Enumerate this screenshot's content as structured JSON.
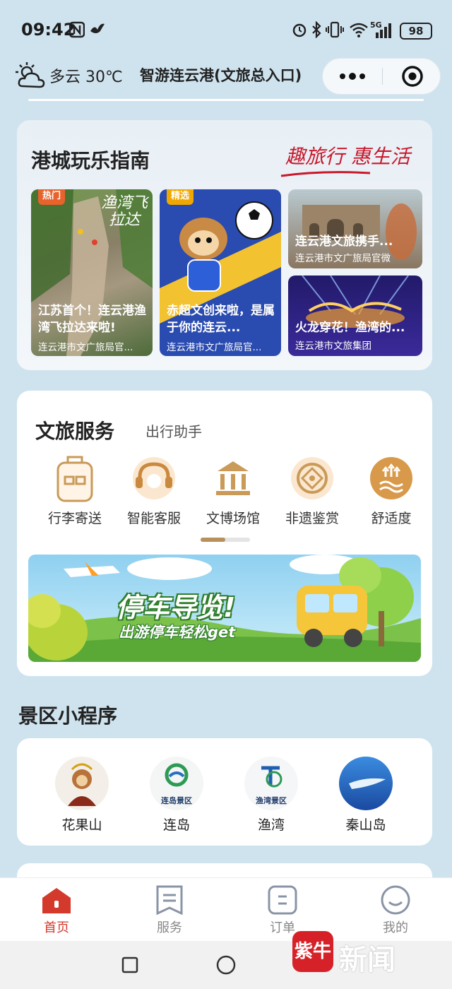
{
  "status_bar": {
    "time": "09:42",
    "battery": "98",
    "network": "5G"
  },
  "header": {
    "weather": "多云 30℃",
    "title": "智游连云港(文旅总入口)"
  },
  "guide": {
    "title": "港城玩乐指南",
    "slogan": "趣旅行 惠生活",
    "tiles": [
      {
        "tag": "热门",
        "art_text": "渔湾飞拉达",
        "title": "江苏首个！连云港渔湾飞拉达来啦!",
        "source": "连云港市文广旅局官..."
      },
      {
        "tag": "精选",
        "title": "赤超文创来啦，是属于你的连云...",
        "source": "连云港市文广旅局官..."
      },
      {
        "title": "连云港文旅携手...",
        "source": "连云港市文广旅局官微"
      },
      {
        "title": "火龙穿花！渔湾的...",
        "source": "连云港市文旅集团"
      }
    ]
  },
  "services": {
    "tabs": [
      "文旅服务",
      "出行助手"
    ],
    "items": [
      {
        "label": "行李寄送",
        "icon": "luggage-icon"
      },
      {
        "label": "智能客服",
        "icon": "headset-icon"
      },
      {
        "label": "文博场馆",
        "icon": "museum-icon"
      },
      {
        "label": "非遗鉴赏",
        "icon": "heritage-icon"
      },
      {
        "label": "舒适度",
        "icon": "comfort-icon"
      }
    ],
    "page_indicator": 0.5,
    "banner": {
      "title": "停车导览!",
      "subtitle": "出游停车轻松get"
    }
  },
  "mini_programs": {
    "title": "景区小程序",
    "items": [
      {
        "label": "花果山"
      },
      {
        "label": "连岛",
        "logo_text": "连岛景区"
      },
      {
        "label": "渔湾",
        "logo_text": "渔湾景区"
      },
      {
        "label": "秦山岛"
      }
    ]
  },
  "tabbar": {
    "items": [
      "首页",
      "服务",
      "订单",
      "我的"
    ],
    "active": "首页"
  },
  "watermark": {
    "badge": "紫牛",
    "text": "新闻"
  },
  "colors": {
    "accent": "#c9182b",
    "gold": "#c99a58",
    "bg": "#cfe3ef"
  }
}
